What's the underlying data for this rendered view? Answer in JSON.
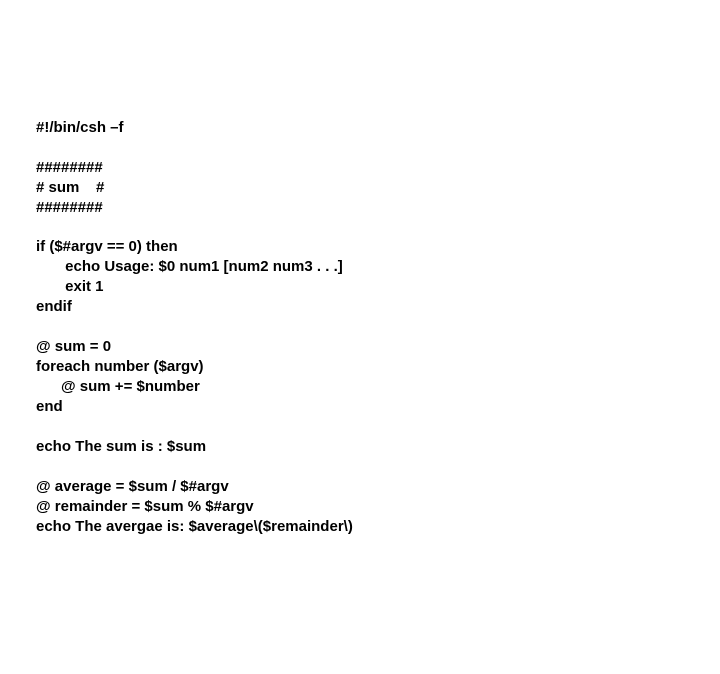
{
  "lines": {
    "l0": "#!/bin/csh –f",
    "l1": "",
    "l2": "########",
    "l3": "# sum    #",
    "l4": "########",
    "l5": "",
    "l6": "if ($#argv == 0) then",
    "l7": "       echo Usage: $0 num1 [num2 num3 . . .]",
    "l8": "       exit 1",
    "l9": "endif",
    "l10": "",
    "l11": "@ sum = 0",
    "l12": "foreach number ($argv)",
    "l13": "      @ sum += $number",
    "l14": "end",
    "l15": "",
    "l16": "echo The sum is : $sum",
    "l17": "",
    "l18": "@ average = $sum / $#argv",
    "l19": "@ remainder = $sum % $#argv",
    "l20": "echo The avergae is: $average\\($remainder\\)"
  }
}
